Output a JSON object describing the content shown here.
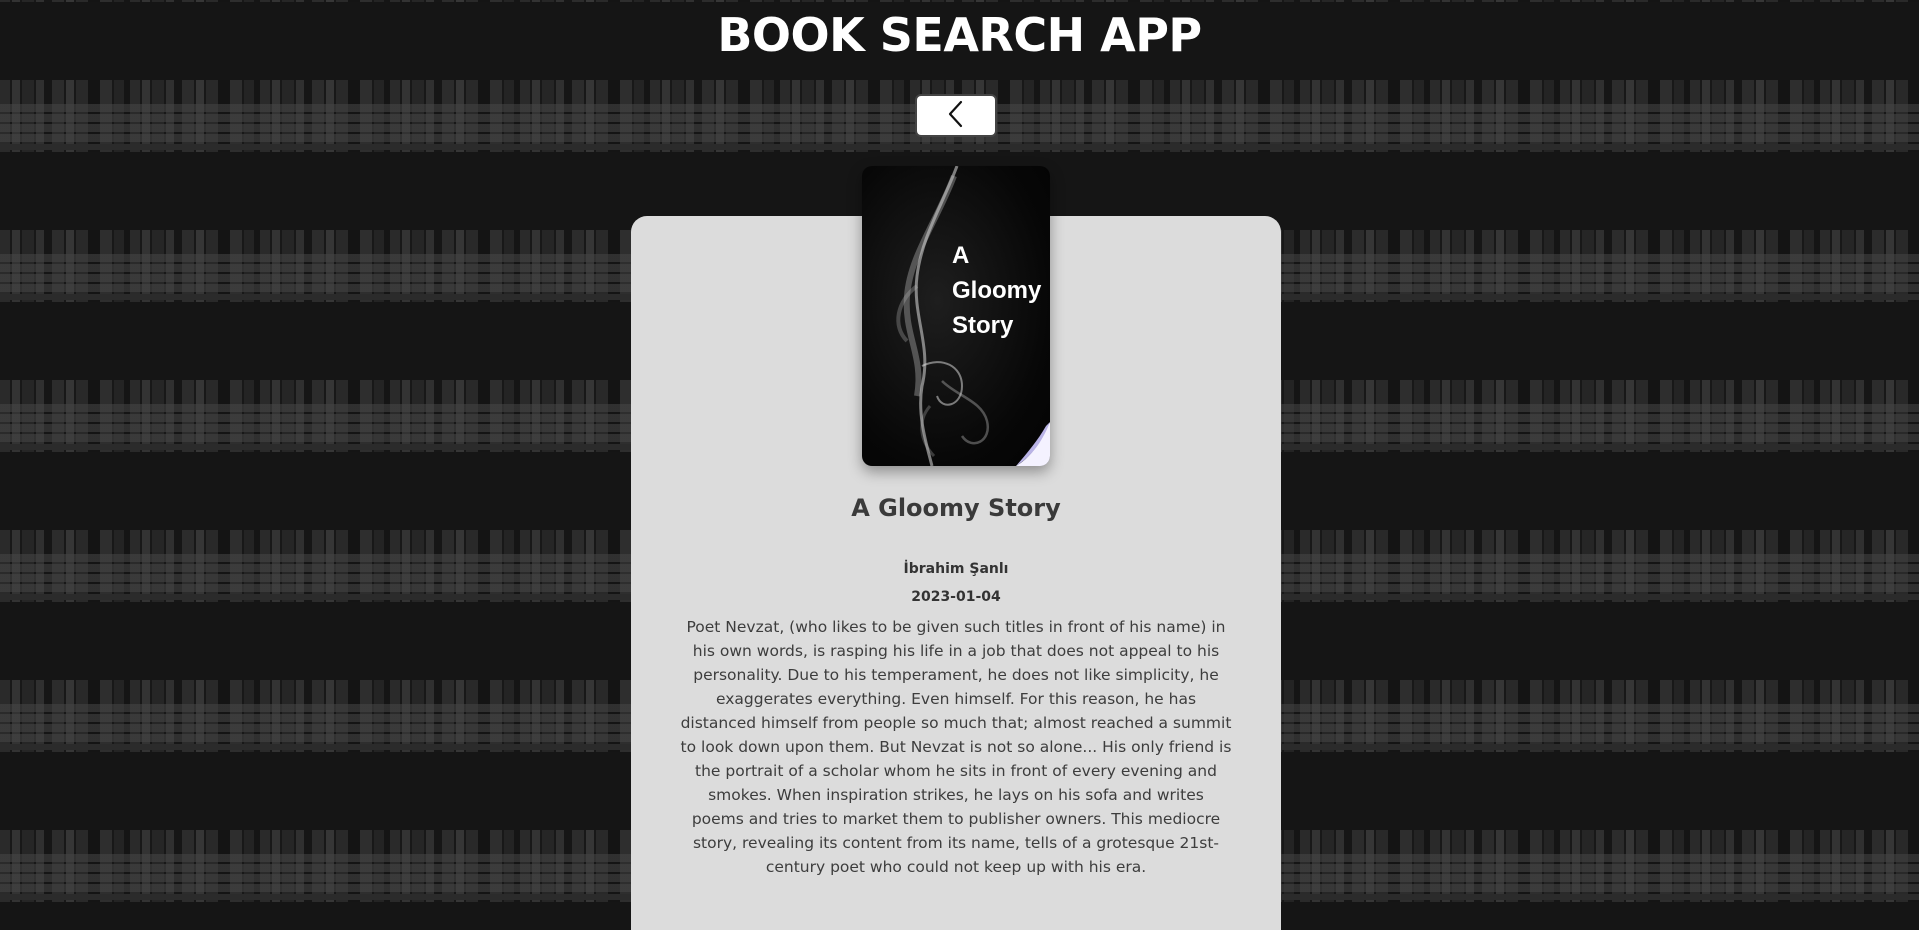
{
  "app": {
    "title": "BOOK SEARCH APP"
  },
  "navigation": {
    "back_icon": "chevron-left-icon"
  },
  "book": {
    "cover_text": "A\nGloomy\nStory",
    "title": "A Gloomy Story",
    "author": "İbrahim Şanlı",
    "published_date": "2023-01-04",
    "description": "Poet Nevzat, (who likes to be given such titles in front of his name) in his own words, is rasping his life in a job that does not appeal to his personality. Due to his temperament, he does not like simplicity, he exaggerates everything. Even himself. For this reason, he has distanced himself from people so much that; almost reached a summit to look down upon them. But Nevzat is not so alone... His only friend is the portrait of a scholar whom he sits in front of every evening and smokes. When inspiration strikes, he lays on his sofa and writes poems and tries to market them to publisher owners. This mediocre story, revealing its content from its name, tells of a grotesque 21st-century poet who could not keep up with his era."
  },
  "colors": {
    "background": "#151515",
    "card": "#dcdcdc",
    "title_text": "#ffffff",
    "body_text": "#3d3d3d"
  }
}
